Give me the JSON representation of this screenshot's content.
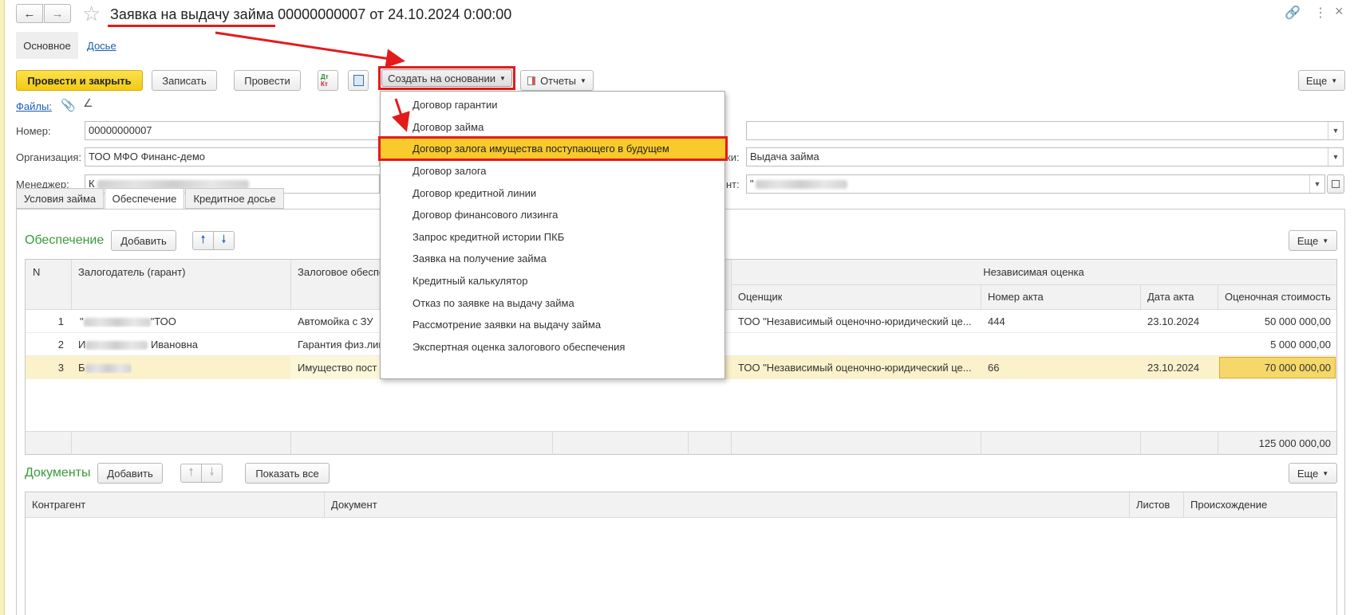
{
  "window": {
    "title_underlined": "Заявка на выдачу займа",
    "title_rest": " 00000000007 от 24.10.2024 0:00:00"
  },
  "nav_tabs": [
    "Основное",
    "Досье"
  ],
  "toolbar": {
    "post_close": "Провести и закрыть",
    "save": "Записать",
    "post": "Провести",
    "create_based": "Создать на основании",
    "reports": "Отчеты",
    "more": "Еще",
    "dt_kt_icon_text": "Дт Кт"
  },
  "files": {
    "label": "Файлы:"
  },
  "fields": {
    "number_label": "Номер:",
    "number_value": "00000000007",
    "org_label": "Организация:",
    "org_value": "ТОО МФО Финанс-демо",
    "manager_label": "Менеджер:",
    "manager_prefix": "К",
    "operation_label_tail": "ки:",
    "operation_value": "Выдача займа",
    "client_label_tail": "нт:",
    "client_value_prefix": "\""
  },
  "dropdown_menu": [
    "Договор гарантии",
    "Договор займа",
    "Договор залога имущества поступающего в будущем",
    "Договор залога",
    "Договор кредитной линии",
    "Договор финансового лизинга",
    "Запрос кредитной истории ПКБ",
    "Заявка на получение займа",
    "Кредитный калькулятор",
    "Отказ по заявке на выдачу займа",
    "Рассмотрение заявки на выдачу займа",
    "Экспертная оценка залогового обеспечения"
  ],
  "dropdown_highlighted_index": 2,
  "form_tabs": [
    "Условия займа",
    "Обеспечение",
    "Кредитное досье"
  ],
  "security": {
    "title": "Обеспечение",
    "add": "Добавить",
    "more": "Еще",
    "columns": {
      "n": "N",
      "pledger": "Залогодатель (гарант)",
      "collateral": "Залоговое обеспе",
      "independent": "Независимая оценка",
      "appraiser": "Оценщик",
      "act_no": "Номер акта",
      "act_date": "Дата акта",
      "value": "Оценочная стоимость"
    },
    "rows": [
      {
        "n": "1",
        "pledger_prefix": "\"",
        "pledger_suffix": "\"ТОО",
        "collateral": "Автомойка с ЗУ",
        "appraiser": "ТОО \"Независимый оценочно-юридический це...",
        "act_no": "444",
        "act_date": "23.10.2024",
        "value": "50 000 000,00"
      },
      {
        "n": "2",
        "pledger_prefix": "И",
        "pledger_suffix": " Ивановна",
        "collateral": "Гарантия физ.лиц",
        "appraiser": "",
        "act_no": "",
        "act_date": "",
        "value": "5 000 000,00"
      },
      {
        "n": "3",
        "pledger_prefix": "Б",
        "pledger_suffix": "",
        "collateral": "Имущество пост",
        "appraiser": "ТОО \"Независимый оценочно-юридический це...",
        "act_no": "66",
        "act_date": "23.10.2024",
        "value": "70 000 000,00"
      }
    ],
    "total": "125 000 000,00"
  },
  "documents": {
    "title": "Документы",
    "add": "Добавить",
    "show_all": "Показать все",
    "more": "Еще",
    "columns": {
      "counterparty": "Контрагент",
      "document": "Документ",
      "sheets": "Листов",
      "origin": "Происхождение"
    }
  },
  "colors": {
    "accent_yellow": "#f5d22e",
    "highlight_red": "#e31b1b",
    "section_green": "#3a9a3a",
    "selected_row": "#fbf2cc"
  }
}
